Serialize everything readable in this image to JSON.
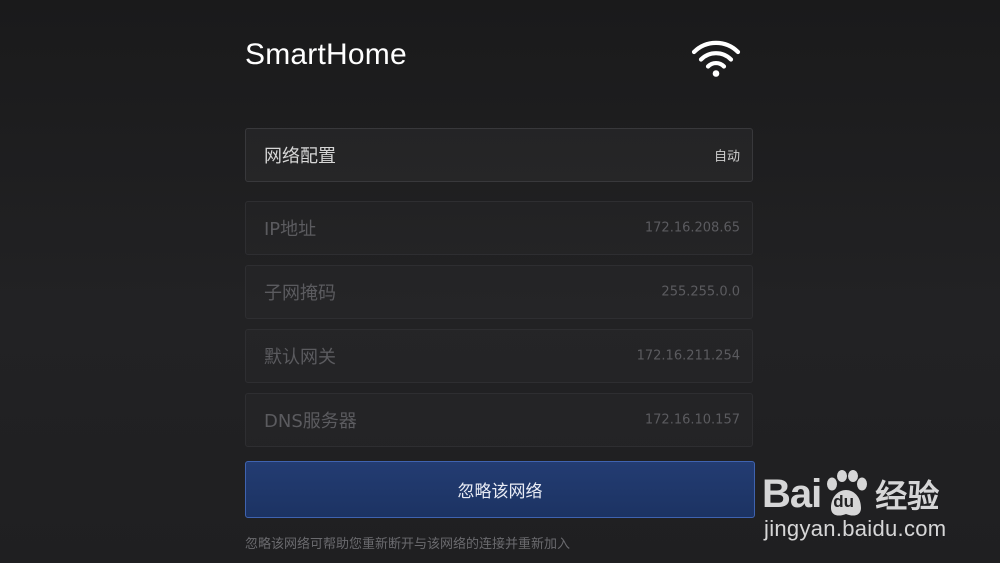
{
  "header": {
    "title": "SmartHome",
    "wifi_icon": "wifi-icon"
  },
  "network_config": {
    "label": "网络配置",
    "value": "自动"
  },
  "fields": [
    {
      "label": "IP地址",
      "value": "172.16.208.65"
    },
    {
      "label": "子网掩码",
      "value": "255.255.0.0"
    },
    {
      "label": "默认网关",
      "value": "172.16.211.254"
    },
    {
      "label": "DNS服务器",
      "value": "172.16.10.157"
    }
  ],
  "forget_button": {
    "label": "忽略该网络"
  },
  "hint": "忽略该网络可帮助您重新断开与该网络的连接并重新加入",
  "watermark": {
    "brand_left": "Bai",
    "brand_paw_text": "du",
    "brand_right": "经验",
    "url": "jingyan.baidu.com"
  },
  "colors": {
    "background": "#1e1e20",
    "button": "#1f3668",
    "button_border": "#3f63b0",
    "dim_text": "#5b5b5f"
  }
}
